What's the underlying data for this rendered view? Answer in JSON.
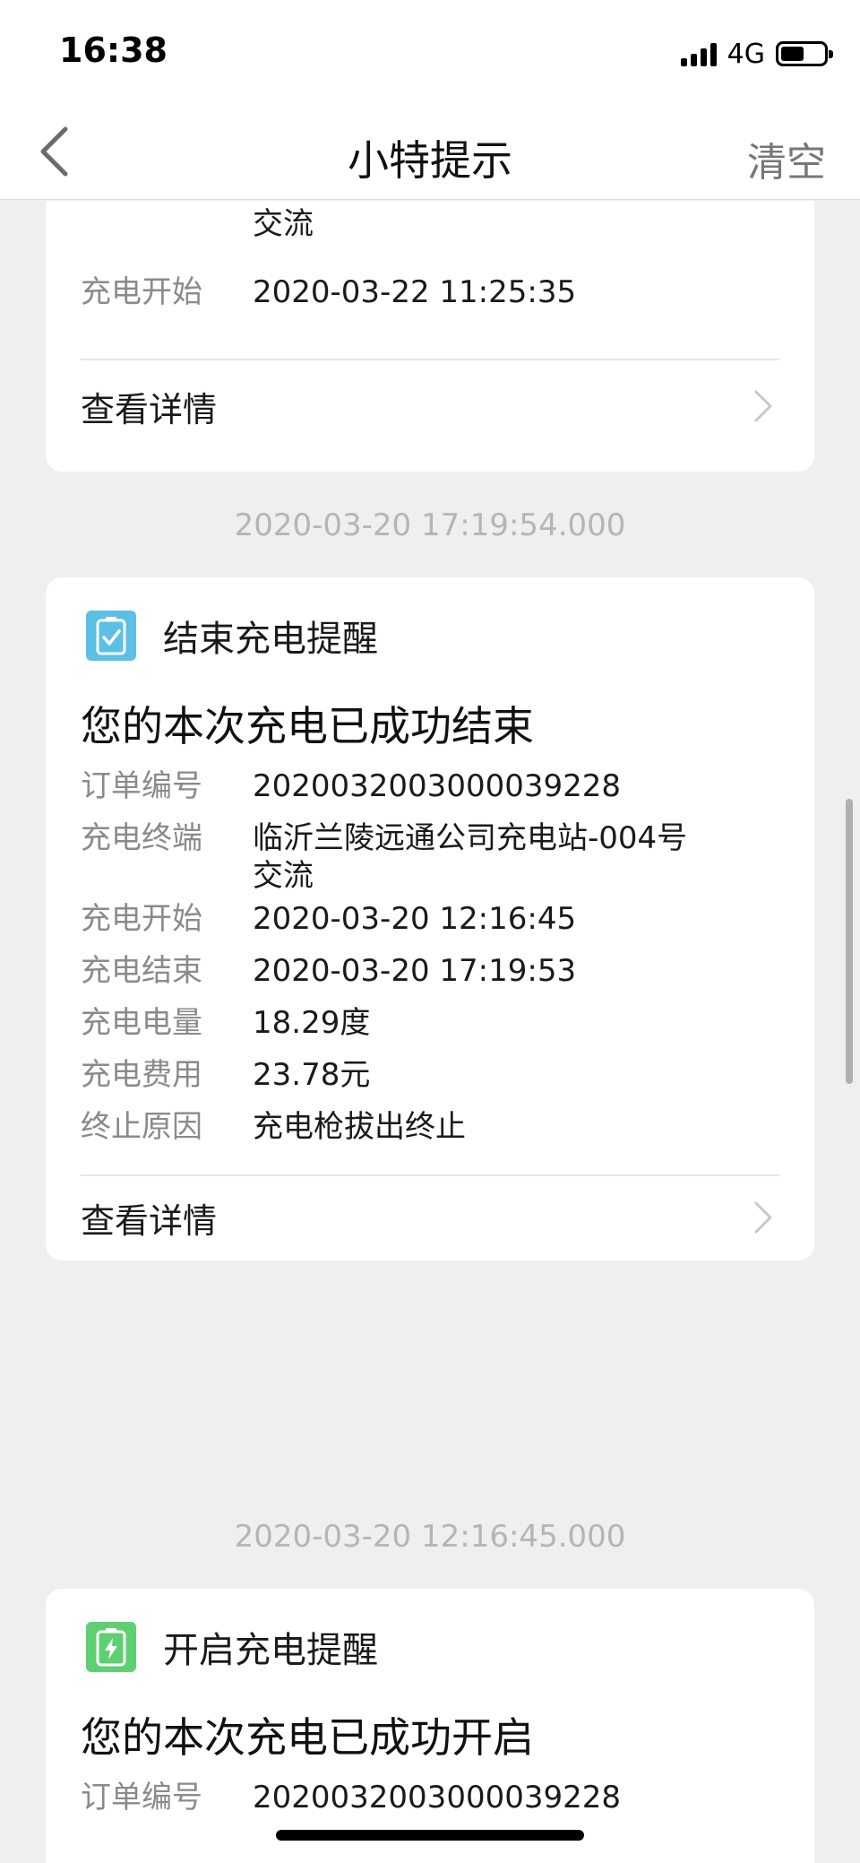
{
  "status_bar": {
    "time": "16:38",
    "network": "4G",
    "battery_percent": 55
  },
  "nav": {
    "title": "小特提示",
    "clear_label": "清空"
  },
  "card_top": {
    "terminal_cont": "交流",
    "start_key": "充电开始",
    "start_value": "2020-03-22 11:25:35",
    "detail_label": "查看详情"
  },
  "ts1": "2020-03-20 17:19:54.000",
  "card_end": {
    "title": "结束充电提醒",
    "icon_color": "#5bbfe6",
    "headline": "您的本次充电已成功结束",
    "rows": [
      {
        "key": "订单编号",
        "value": "2020032003000039228"
      },
      {
        "key": "充电终端",
        "value": "临沂兰陵远通公司充电站-004号",
        "value2": "交流"
      },
      {
        "key": "充电开始",
        "value": "2020-03-20 12:16:45"
      },
      {
        "key": "充电结束",
        "value": "2020-03-20 17:19:53"
      },
      {
        "key": "充电电量",
        "value": "18.29度"
      },
      {
        "key": "充电费用",
        "value": "23.78元"
      },
      {
        "key": "终止原因",
        "value": "充电枪拔出终止"
      }
    ],
    "detail_label": "查看详情"
  },
  "ts2": "2020-03-20 12:16:45.000",
  "card_start": {
    "title": "开启充电提醒",
    "icon_color": "#5fd071",
    "headline": "您的本次充电已成功开启",
    "rows": [
      {
        "key": "订单编号",
        "value": "2020032003000039228"
      }
    ]
  }
}
